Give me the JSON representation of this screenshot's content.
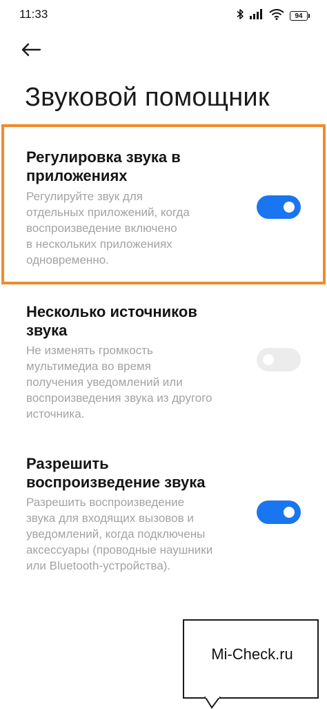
{
  "status_bar": {
    "time": "11:33",
    "battery": "94",
    "icons": [
      "bluetooth-icon",
      "signal-icon",
      "wifi-icon",
      "battery-icon"
    ]
  },
  "header": {
    "back_icon": "arrow-left-icon",
    "title": "Звуковой помощник"
  },
  "settings": [
    {
      "title_line1": "Регулировка звука в",
      "title_line2": "приложениях",
      "desc_lines": [
        "Регулируйте звук для",
        "отдельных приложений, когда",
        "воспроизведение включено",
        "в нескольких приложениях",
        "одновременно."
      ],
      "enabled": true
    },
    {
      "title_line1": "Несколько источников",
      "title_line2": "звука",
      "desc_lines": [
        "Не изменять громкость",
        "мультимедиа во время",
        "получения уведомлений или",
        "воспроизведения звука из другого",
        "источника."
      ],
      "enabled": false
    },
    {
      "title_line1": "Разрешить",
      "title_line2": "воспроизведение звука",
      "desc_lines": [
        "Разрешить воспроизведение",
        "звука для входящих вызовов и",
        "уведомлений, когда подключены",
        "аксессуары (проводные наушники",
        "или Bluetooth-устройства)."
      ],
      "enabled": true
    }
  ],
  "colors": {
    "accent": "#1976f0",
    "highlight": "#f28a2a",
    "toggle_off": "#ececec",
    "secondary_text": "#a3a3a3"
  },
  "watermark": {
    "text": "Mi-Check.ru"
  }
}
